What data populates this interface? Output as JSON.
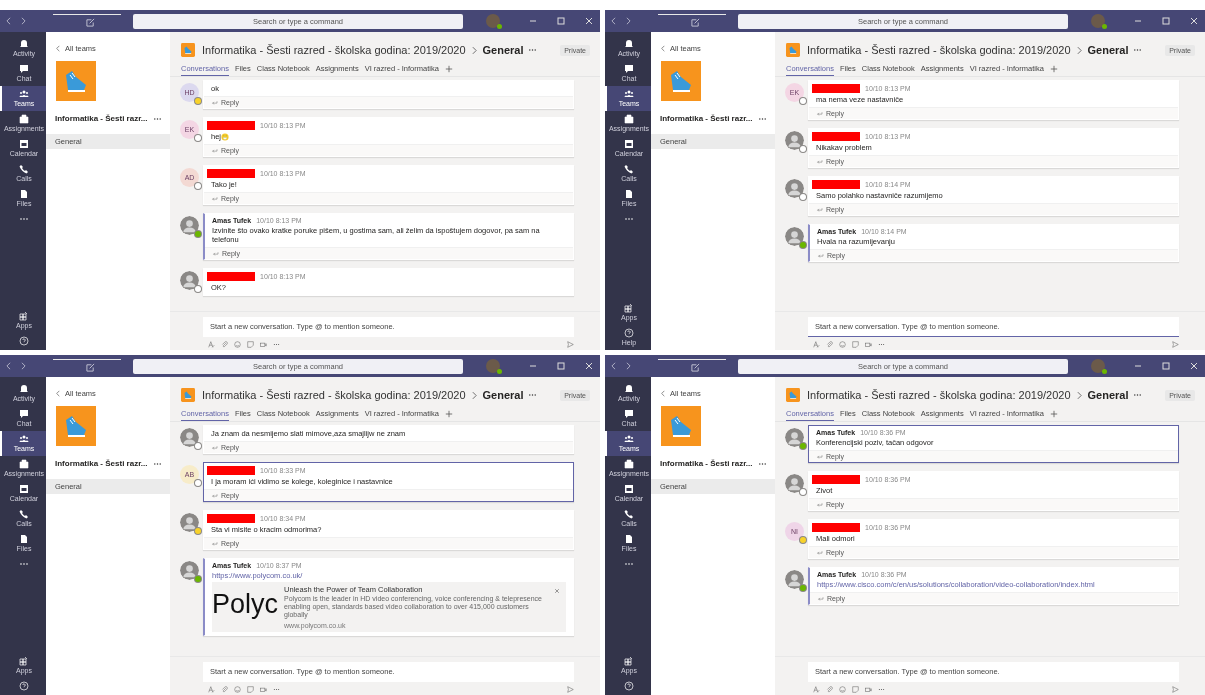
{
  "windows": [
    {
      "titlebar": {
        "search_placeholder": "Search or type a command"
      },
      "rail": {
        "items": [
          {
            "kind": "activity",
            "label": "Activity",
            "selected": false
          },
          {
            "kind": "chat",
            "label": "Chat",
            "selected": false
          },
          {
            "kind": "teams",
            "label": "Teams",
            "selected": true
          },
          {
            "kind": "assignments",
            "label": "Assignments",
            "selected": false
          },
          {
            "kind": "calendar",
            "label": "Calendar",
            "selected": false
          },
          {
            "kind": "calls",
            "label": "Calls",
            "selected": false
          },
          {
            "kind": "files",
            "label": "Files",
            "selected": false
          },
          {
            "kind": "more",
            "selected": false
          }
        ],
        "bottom_items": [
          {
            "kind": "apps",
            "label": "Apps",
            "selected": false
          },
          {
            "kind": "help",
            "selected": false
          }
        ]
      },
      "panel": {
        "back_label": "All teams",
        "team_name": "Informatika - Šesti razr...",
        "channels": [
          {
            "label": "General",
            "selected": true
          }
        ]
      },
      "header": {
        "team": "Informatika - Šesti razred - školska godina: 2019/2020",
        "channel": "General",
        "badge": "Private"
      },
      "tabs": [
        {
          "label": "Conversations",
          "selected": true
        },
        {
          "label": "Files",
          "selected": false
        },
        {
          "label": "Class Notebook",
          "selected": false
        },
        {
          "label": "Assignments",
          "selected": false
        },
        {
          "label": "VI razred - Informatika",
          "selected": false
        }
      ],
      "messages": [
        {
          "avatar": {
            "kind": "initials",
            "initials": "HD",
            "color": "#dcd9ef"
          },
          "presence": {
            "color": "#f8d22a"
          },
          "text": "ok",
          "reply": "Reply",
          "own": false,
          "highlighted": false
        },
        {
          "avatar": {
            "kind": "initials",
            "initials": "EK",
            "color": "#f4d6e4"
          },
          "presence": {
            "color": "#ffffff"
          },
          "redacted": true,
          "time": "10/10 8:13 PM",
          "text": "hej",
          "emoji": true,
          "reply": "Reply",
          "own": false,
          "highlighted": false
        },
        {
          "avatar": {
            "kind": "initials",
            "initials": "AD",
            "color": "#f3d9d3"
          },
          "presence": {
            "color": "#ffffff"
          },
          "redacted": true,
          "time": "10/10 8:13 PM",
          "text": "Tako je!",
          "reply": "Reply",
          "own": false,
          "highlighted": false
        },
        {
          "avatar": {
            "kind": "photo"
          },
          "presence": {
            "color": "#6bb700"
          },
          "author": "Amas Tufek",
          "time": "10/10 8:13 PM",
          "text": "Izvinite što ovako kratke poruke pišem, u gostima sam, ali želim da ispoštujem dogovor, pa sam na telefonu",
          "reply": "Reply",
          "own": true,
          "highlighted": false
        },
        {
          "avatar": {
            "kind": "photo"
          },
          "presence": {
            "color": "#ffffff"
          },
          "redacted": true,
          "time": "10/10 8:13 PM",
          "text": "OK?",
          "own": false,
          "highlighted": false
        }
      ],
      "composer": {
        "placeholder": "Start a new conversation. Type @ to mention someone.",
        "focused": false
      }
    },
    {
      "titlebar": {
        "search_placeholder": "Search or type a command"
      },
      "rail": {
        "items": [
          {
            "kind": "activity",
            "label": "Activity",
            "selected": false
          },
          {
            "kind": "chat",
            "label": "Chat",
            "selected": false
          },
          {
            "kind": "teams",
            "label": "Teams",
            "selected": true
          },
          {
            "kind": "assignments",
            "label": "Assignments",
            "selected": false
          },
          {
            "kind": "calendar",
            "label": "Calendar",
            "selected": false
          },
          {
            "kind": "calls",
            "label": "Calls",
            "selected": false
          },
          {
            "kind": "files",
            "label": "Files",
            "selected": false
          },
          {
            "kind": "more",
            "selected": false
          }
        ],
        "bottom_items": [
          {
            "kind": "apps",
            "label": "Apps",
            "selected": false
          },
          {
            "kind": "help",
            "label": "Help",
            "selected": false
          }
        ]
      },
      "panel": {
        "back_label": "All teams",
        "team_name": "Informatika - Šesti razr...",
        "channels": [
          {
            "label": "General",
            "selected": true
          }
        ]
      },
      "header": {
        "team": "Informatika - Šesti razred - školska godina: 2019/2020",
        "channel": "General",
        "badge": "Private"
      },
      "tabs": [
        {
          "label": "Conversations",
          "selected": true
        },
        {
          "label": "Files",
          "selected": false
        },
        {
          "label": "Class Notebook",
          "selected": false
        },
        {
          "label": "Assignments",
          "selected": false
        },
        {
          "label": "VI razred - Informatika",
          "selected": false
        }
      ],
      "messages": [
        {
          "avatar": {
            "kind": "initials",
            "initials": "EK",
            "color": "#f4d6e4"
          },
          "presence": {
            "color": "#ffffff"
          },
          "redacted": true,
          "time": "10/10 8:13 PM",
          "text": "ma nema veze nastavniče",
          "reply": "Reply",
          "own": false,
          "highlighted": false
        },
        {
          "avatar": {
            "kind": "photo"
          },
          "presence": {
            "color": "#ffffff"
          },
          "redacted": true,
          "time": "10/10 8:13 PM",
          "text": "Nikakav problem",
          "reply": "Reply",
          "own": false,
          "highlighted": false
        },
        {
          "avatar": {
            "kind": "photo"
          },
          "presence": {
            "color": "#ffffff"
          },
          "redacted": true,
          "time": "10/10 8:14 PM",
          "text": "Samo polahko nastavniče razumijemo",
          "reply": "Reply",
          "own": false,
          "highlighted": false
        },
        {
          "avatar": {
            "kind": "photo"
          },
          "presence": {
            "color": "#6bb700"
          },
          "author": "Amas Tufek",
          "time": "10/10 8:14 PM",
          "text": "Hvala na razumijevanju",
          "reply": "Reply",
          "own": true,
          "highlighted": false
        }
      ],
      "composer": {
        "placeholder": "Start a new conversation. Type @ to mention someone.",
        "focused": true
      }
    },
    {
      "titlebar": {
        "search_placeholder": "Search or type a command"
      },
      "rail": {
        "items": [
          {
            "kind": "activity",
            "label": "Activity",
            "selected": false
          },
          {
            "kind": "chat",
            "label": "Chat",
            "selected": false
          },
          {
            "kind": "teams",
            "label": "Teams",
            "selected": true
          },
          {
            "kind": "assignments",
            "label": "Assignments",
            "selected": false
          },
          {
            "kind": "calendar",
            "label": "Calendar",
            "selected": false
          },
          {
            "kind": "calls",
            "label": "Calls",
            "selected": false
          },
          {
            "kind": "files",
            "label": "Files",
            "selected": false
          },
          {
            "kind": "more",
            "selected": false
          }
        ],
        "bottom_items": [
          {
            "kind": "apps",
            "label": "Apps",
            "selected": false
          },
          {
            "kind": "help",
            "selected": false
          }
        ]
      },
      "panel": {
        "back_label": "All teams",
        "team_name": "Informatika - Šesti razr...",
        "channels": [
          {
            "label": "General",
            "selected": true
          }
        ]
      },
      "header": {
        "team": "Informatika - Šesti razred - školska godina: 2019/2020",
        "channel": "General",
        "badge": "Private"
      },
      "tabs": [
        {
          "label": "Conversations",
          "selected": true
        },
        {
          "label": "Files",
          "selected": false
        },
        {
          "label": "Class Notebook",
          "selected": false
        },
        {
          "label": "Assignments",
          "selected": false
        },
        {
          "label": "VI razred - Informatika",
          "selected": false
        }
      ],
      "messages": [
        {
          "avatar": {
            "kind": "photo"
          },
          "presence": {
            "color": "#ffffff"
          },
          "text": "Ja znam da nesmijemo slati mimove,aza smajlijw ne znam",
          "reply": "Reply",
          "own": false,
          "highlighted": false
        },
        {
          "avatar": {
            "kind": "initials",
            "initials": "AB",
            "color": "#f7ecc9"
          },
          "presence": {
            "color": "#ffffff"
          },
          "redacted": true,
          "time": "10/10 8:33 PM",
          "text": "I ja moram ići vidimo se kolege, koleginice i nastavnice",
          "reply": "Reply",
          "own": false,
          "highlighted": true
        },
        {
          "avatar": {
            "kind": "photo"
          },
          "presence": {
            "color": "#f8d22a"
          },
          "redacted": true,
          "time": "10/10 8:34 PM",
          "text": "Sta vi misite o kracim odmorima?",
          "reply": "Reply",
          "own": false,
          "highlighted": false
        },
        {
          "avatar": {
            "kind": "photo"
          },
          "presence": {
            "color": "#6bb700"
          },
          "author": "Amas Tufek",
          "time": "10/10 8:37 PM",
          "link": "https://www.polycom.co.uk/",
          "preview": {
            "logo": "Polyc",
            "title": "Unleash the Power of Team Collaboration",
            "description": "Polycom is the leader in HD video conferencing, voice conferencing & telepresence enabling open, standards based video collaboration to over 415,000 customers globally",
            "domain": "www.polycom.co.uk"
          },
          "own": true,
          "highlighted": false
        }
      ],
      "composer": {
        "placeholder": "Start a new conversation. Type @ to mention someone.",
        "focused": false
      }
    },
    {
      "titlebar": {
        "search_placeholder": "Search or type a command"
      },
      "rail": {
        "items": [
          {
            "kind": "activity",
            "label": "Activity",
            "selected": false
          },
          {
            "kind": "chat",
            "label": "Chat",
            "selected": false
          },
          {
            "kind": "teams",
            "label": "Teams",
            "selected": true
          },
          {
            "kind": "assignments",
            "label": "Assignments",
            "selected": false
          },
          {
            "kind": "calendar",
            "label": "Calendar",
            "selected": false
          },
          {
            "kind": "calls",
            "label": "Calls",
            "selected": false
          },
          {
            "kind": "files",
            "label": "Files",
            "selected": false
          },
          {
            "kind": "more",
            "selected": false
          }
        ],
        "bottom_items": [
          {
            "kind": "apps",
            "label": "Apps",
            "selected": false
          },
          {
            "kind": "help",
            "selected": false
          }
        ]
      },
      "panel": {
        "back_label": "All teams",
        "team_name": "Informatika - Šesti razr...",
        "channels": [
          {
            "label": "General",
            "selected": true
          }
        ]
      },
      "header": {
        "team": "Informatika - Šesti razred - školska godina: 2019/2020",
        "channel": "General",
        "badge": "Private"
      },
      "tabs": [
        {
          "label": "Conversations",
          "selected": true
        },
        {
          "label": "Files",
          "selected": false
        },
        {
          "label": "Class Notebook",
          "selected": false
        },
        {
          "label": "Assignments",
          "selected": false
        },
        {
          "label": "VI razred - Informatika",
          "selected": false
        }
      ],
      "messages": [
        {
          "avatar": {
            "kind": "photo"
          },
          "presence": {
            "color": "#6bb700"
          },
          "author": "Amas Tufek",
          "time": "10/10 8:36 PM",
          "text": "Konferencijski poziv, tačan odgovor",
          "reply": "Reply",
          "own": true,
          "highlighted": true
        },
        {
          "avatar": {
            "kind": "photo"
          },
          "presence": {
            "color": "#ffffff"
          },
          "redacted": true,
          "time": "10/10 8:36 PM",
          "text": "Zivot",
          "reply": "Reply",
          "own": false,
          "highlighted": false
        },
        {
          "avatar": {
            "kind": "initials",
            "initials": "NI",
            "color": "#efd5e8"
          },
          "presence": {
            "color": "#f8d22a"
          },
          "redacted": true,
          "time": "10/10 8:36 PM",
          "text": "Mali odmori",
          "reply": "Reply",
          "own": false,
          "highlighted": false
        },
        {
          "avatar": {
            "kind": "photo"
          },
          "presence": {
            "color": "#6bb700"
          },
          "author": "Amas Tufek",
          "time": "10/10 8:36 PM",
          "link": "https://www.cisco.com/c/en/us/solutions/collaboration/video-collaboration/index.html",
          "reply": "Reply",
          "own": true,
          "highlighted": false
        }
      ],
      "composer": {
        "placeholder": "Start a new conversation. Type @ to mention someone.",
        "focused": false
      }
    }
  ]
}
